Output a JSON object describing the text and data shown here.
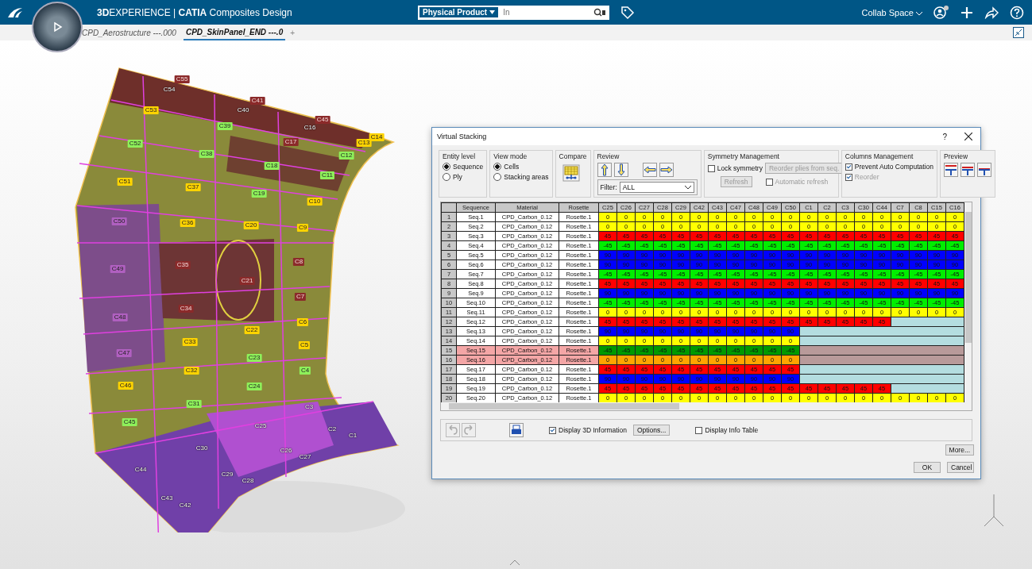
{
  "app": {
    "title": "**3D**EXPERIENCE | **CATIA** Composites Design",
    "search": {
      "scope": "Physical Product",
      "placeholder": "In"
    },
    "collab_space": "Collab Space"
  },
  "tabs": [
    {
      "label": "CPD_Aerostructure ---.000",
      "selected": false
    },
    {
      "label": "CPD_SkinPanel_END ---.0",
      "selected": true
    }
  ],
  "new_tab": "+",
  "zones": [
    {
      "label": "C55",
      "color": "#8b2a2a"
    },
    {
      "label": "C54"
    },
    {
      "label": "C41",
      "color": "#8b2a2a"
    },
    {
      "label": "C40"
    },
    {
      "label": "C45",
      "color": "#8b2a2a"
    },
    {
      "label": "C16"
    },
    {
      "label": "C14",
      "color": "#ffd400"
    },
    {
      "label": "C13",
      "color": "#ffd400"
    },
    {
      "label": "C53",
      "color": "#ffd400"
    },
    {
      "label": "C39",
      "color": "#8ef05a"
    },
    {
      "label": "C17",
      "color": "#8b2a2a"
    },
    {
      "label": "C12",
      "color": "#8ef05a"
    },
    {
      "label": "C52",
      "color": "#8ef05a"
    },
    {
      "label": "C38",
      "color": "#8ef05a"
    },
    {
      "label": "C18",
      "color": "#8ef05a"
    },
    {
      "label": "C11",
      "color": "#8ef05a"
    },
    {
      "label": "C51",
      "color": "#ffd400"
    },
    {
      "label": "C37",
      "color": "#ffd400"
    },
    {
      "label": "C19",
      "color": "#8ef05a"
    },
    {
      "label": "C10",
      "color": "#ffd400"
    },
    {
      "label": "C50",
      "color": "#b060c0"
    },
    {
      "label": "C36",
      "color": "#ffd400"
    },
    {
      "label": "C20",
      "color": "#ffd400"
    },
    {
      "label": "C9",
      "color": "#ffd400"
    },
    {
      "label": "C49",
      "color": "#b060c0"
    },
    {
      "label": "C35",
      "color": "#8b2a2a"
    },
    {
      "label": "C21",
      "color": "#8b2a2a"
    },
    {
      "label": "C8",
      "color": "#8b2a2a"
    },
    {
      "label": "C7",
      "color": "#8b2a2a"
    },
    {
      "label": "C34",
      "color": "#8b2a2a"
    },
    {
      "label": "C48",
      "color": "#b060c0"
    },
    {
      "label": "C22",
      "color": "#ffd400"
    },
    {
      "label": "C6",
      "color": "#ffd400"
    },
    {
      "label": "C33",
      "color": "#ffd400"
    },
    {
      "label": "C5",
      "color": "#ffd400"
    },
    {
      "label": "C47",
      "color": "#b060c0"
    },
    {
      "label": "C23",
      "color": "#8ef05a"
    },
    {
      "label": "C4",
      "color": "#8ef05a"
    },
    {
      "label": "C32",
      "color": "#ffd400"
    },
    {
      "label": "C46",
      "color": "#ffd400"
    },
    {
      "label": "C24",
      "color": "#8ef05a"
    },
    {
      "label": "C31",
      "color": "#8ef05a"
    },
    {
      "label": "C45",
      "color": "#8ef05a"
    },
    {
      "label": "C3"
    },
    {
      "label": "C25"
    },
    {
      "label": "C2"
    },
    {
      "label": "C1"
    },
    {
      "label": "C30"
    },
    {
      "label": "C26"
    },
    {
      "label": "C27"
    },
    {
      "label": "C44"
    },
    {
      "label": "C29"
    },
    {
      "label": "C28"
    },
    {
      "label": "C43"
    },
    {
      "label": "C42"
    }
  ],
  "dialog": {
    "title": "Virtual Stacking",
    "help": "?",
    "entity_level": {
      "label": "Entity level",
      "options": [
        {
          "label": "Sequence",
          "selected": true
        },
        {
          "label": "Ply",
          "selected": false
        }
      ]
    },
    "view_mode": {
      "label": "View mode",
      "options": [
        {
          "label": "Cells",
          "selected": true
        },
        {
          "label": "Stacking areas",
          "selected": false
        }
      ]
    },
    "compare": {
      "label": "Compare"
    },
    "review": {
      "label": "Review",
      "filter_label": "Filter:",
      "filter_value": "ALL"
    },
    "symmetry": {
      "label": "Symmetry Management",
      "lock": {
        "label": "Lock symmetry",
        "checked": false
      },
      "reorder_button": {
        "label": "Reorder plies from seq.",
        "disabled": true
      },
      "refresh_button": {
        "label": "Refresh",
        "disabled": true
      },
      "auto_refresh": {
        "label": "Automatic refresh",
        "checked": false,
        "disabled": true
      }
    },
    "columns_management": {
      "label": "Columns Management",
      "prevent": {
        "label": "Prevent Auto Computation",
        "checked": true,
        "disabled": false
      },
      "reorder": {
        "label": "Reorder",
        "checked": true,
        "disabled": true
      }
    },
    "preview": {
      "label": "Preview"
    },
    "table": {
      "columns": [
        "Sequence",
        "Material",
        "Rosette"
      ],
      "zone_columns": [
        "C25",
        "C26",
        "C27",
        "C28",
        "C29",
        "C42",
        "C43",
        "C47",
        "C48",
        "C49",
        "C50",
        "C1",
        "C2",
        "C3",
        "C30",
        "C44",
        "C7",
        "C8",
        "C15",
        "C16"
      ],
      "rows": [
        {
          "number": "1",
          "sequence": "Seq.1",
          "material": "CPD_Carbon_0.12",
          "rosette": "Rosette.1",
          "highlighted": false,
          "color": "#ffff00",
          "cells": [
            "0",
            "0",
            "0",
            "0",
            "0",
            "0",
            "0",
            "0",
            "0",
            "0",
            "0",
            "0",
            "0",
            "0",
            "0",
            "0",
            "0",
            "0",
            "0",
            "0"
          ]
        },
        {
          "number": "2",
          "sequence": "Seq.2",
          "material": "CPD_Carbon_0.12",
          "rosette": "Rosette.1",
          "highlighted": false,
          "color": "#ffff00",
          "cells": [
            "0",
            "0",
            "0",
            "0",
            "0",
            "0",
            "0",
            "0",
            "0",
            "0",
            "0",
            "0",
            "0",
            "0",
            "0",
            "0",
            "0",
            "0",
            "0",
            "0"
          ]
        },
        {
          "number": "3",
          "sequence": "Seq.3",
          "material": "CPD_Carbon_0.12",
          "rosette": "Rosette.1",
          "highlighted": false,
          "color": "#ff0000",
          "cells": [
            "45",
            "45",
            "45",
            "45",
            "45",
            "45",
            "45",
            "45",
            "45",
            "45",
            "45",
            "45",
            "45",
            "45",
            "45",
            "45",
            "45",
            "45",
            "45",
            "45"
          ]
        },
        {
          "number": "4",
          "sequence": "Seq.4",
          "material": "CPD_Carbon_0.12",
          "rosette": "Rosette.1",
          "highlighted": false,
          "color": "#00ee00",
          "cells": [
            "-45",
            "-45",
            "-45",
            "-45",
            "-45",
            "-45",
            "-45",
            "-45",
            "-45",
            "-45",
            "-45",
            "-45",
            "-45",
            "-45",
            "-45",
            "-45",
            "-45",
            "-45",
            "-45",
            "-45"
          ]
        },
        {
          "number": "5",
          "sequence": "Seq.5",
          "material": "CPD_Carbon_0.12",
          "rosette": "Rosette.1",
          "highlighted": false,
          "color": "#0000ff",
          "cells": [
            "90",
            "90",
            "90",
            "90",
            "90",
            "90",
            "90",
            "90",
            "90",
            "90",
            "90",
            "90",
            "90",
            "90",
            "90",
            "90",
            "90",
            "90",
            "90",
            "90"
          ]
        },
        {
          "number": "6",
          "sequence": "Seq.6",
          "material": "CPD_Carbon_0.12",
          "rosette": "Rosette.1",
          "highlighted": false,
          "color": "#0000ff",
          "cells": [
            "90",
            "90",
            "90",
            "90",
            "90",
            "90",
            "90",
            "90",
            "90",
            "90",
            "90",
            "90",
            "90",
            "90",
            "90",
            "90",
            "90",
            "90",
            "90",
            "90"
          ]
        },
        {
          "number": "7",
          "sequence": "Seq.7",
          "material": "CPD_Carbon_0.12",
          "rosette": "Rosette.1",
          "highlighted": false,
          "color": "#00ee00",
          "cells": [
            "-45",
            "-45",
            "-45",
            "-45",
            "-45",
            "-45",
            "-45",
            "-45",
            "-45",
            "-45",
            "-45",
            "-45",
            "-45",
            "-45",
            "-45",
            "-45",
            "-45",
            "-45",
            "-45",
            "-45"
          ]
        },
        {
          "number": "8",
          "sequence": "Seq.8",
          "material": "CPD_Carbon_0.12",
          "rosette": "Rosette.1",
          "highlighted": false,
          "color": "#ff0000",
          "cells": [
            "45",
            "45",
            "45",
            "45",
            "45",
            "45",
            "45",
            "45",
            "45",
            "45",
            "45",
            "45",
            "45",
            "45",
            "45",
            "45",
            "45",
            "45",
            "45",
            "45"
          ]
        },
        {
          "number": "9",
          "sequence": "Seq.9",
          "material": "CPD_Carbon_0.12",
          "rosette": "Rosette.1",
          "highlighted": false,
          "color": "#0000ff",
          "cells": [
            "90",
            "90",
            "90",
            "90",
            "90",
            "90",
            "90",
            "90",
            "90",
            "90",
            "90",
            "90",
            "90",
            "90",
            "90",
            "90",
            "90",
            "90",
            "90",
            "90"
          ]
        },
        {
          "number": "10",
          "sequence": "Seq.10",
          "material": "CPD_Carbon_0.12",
          "rosette": "Rosette.1",
          "highlighted": false,
          "color": "#00ee00",
          "cells": [
            "-45",
            "-45",
            "-45",
            "-45",
            "-45",
            "-45",
            "-45",
            "-45",
            "-45",
            "-45",
            "-45",
            "-45",
            "-45",
            "-45",
            "-45",
            "-45",
            "-45",
            "-45",
            "-45",
            "-45"
          ]
        },
        {
          "number": "11",
          "sequence": "Seq.11",
          "material": "CPD_Carbon_0.12",
          "rosette": "Rosette.1",
          "highlighted": false,
          "color": "#ffff00",
          "cells": [
            "0",
            "0",
            "0",
            "0",
            "0",
            "0",
            "0",
            "0",
            "0",
            "0",
            "0",
            "0",
            "0",
            "0",
            "0",
            "0",
            "0",
            "0",
            "0",
            "0"
          ]
        },
        {
          "number": "12",
          "sequence": "Seq.12",
          "material": "CPD_Carbon_0.12",
          "rosette": "Rosette.1",
          "highlighted": false,
          "color": "#ff0000",
          "blank_area": {
            "color": "#b4dde0"
          },
          "cells": [
            "45",
            "45",
            "45",
            "45",
            "45",
            "45",
            "45",
            "45",
            "45",
            "45",
            "45",
            "45",
            "45",
            "45",
            "45",
            "45"
          ]
        },
        {
          "number": "13",
          "sequence": "Seq.13",
          "material": "CPD_Carbon_0.12",
          "rosette": "Rosette.1",
          "highlighted": false,
          "color": "#0000ff",
          "blank_area": {
            "color": "#b4dde0"
          },
          "cells": [
            "90",
            "90",
            "90",
            "90",
            "90",
            "90",
            "90",
            "90",
            "90",
            "90",
            "90"
          ]
        },
        {
          "number": "14",
          "sequence": "Seq.14",
          "material": "CPD_Carbon_0.12",
          "rosette": "Rosette.1",
          "highlighted": false,
          "color": "#ffff00",
          "blank_area": {
            "color": "#b4dde0"
          },
          "cells": [
            "0",
            "0",
            "0",
            "0",
            "0",
            "0",
            "0",
            "0",
            "0",
            "0",
            "0"
          ]
        },
        {
          "number": "15",
          "sequence": "Seq.15",
          "material": "CPD_Carbon_0.12",
          "rosette": "Rosette.1",
          "highlighted": true,
          "color": "#009900",
          "blank_area": {
            "color": "#b89a9a"
          },
          "cells": [
            "-45",
            "-45",
            "-45",
            "-45",
            "-45",
            "-45",
            "-45",
            "-45",
            "-45",
            "-45",
            "-45"
          ]
        },
        {
          "number": "16",
          "sequence": "Seq.16",
          "material": "CPD_Carbon_0.12",
          "rosette": "Rosette.1",
          "highlighted": true,
          "color": "#ffa500",
          "blank_area": {
            "color": "#b89a9a"
          },
          "cells": [
            "0",
            "0",
            "0",
            "0",
            "0",
            "0",
            "0",
            "0",
            "0",
            "0",
            "0"
          ]
        },
        {
          "number": "17",
          "sequence": "Seq.17",
          "material": "CPD_Carbon_0.12",
          "rosette": "Rosette.1",
          "highlighted": false,
          "color": "#ff0000",
          "blank_area": {
            "color": "#b4dde0"
          },
          "cells": [
            "45",
            "45",
            "45",
            "45",
            "45",
            "45",
            "45",
            "45",
            "45",
            "45",
            "45"
          ]
        },
        {
          "number": "18",
          "sequence": "Seq.18",
          "material": "CPD_Carbon_0.12",
          "rosette": "Rosette.1",
          "highlighted": false,
          "color": "#0000ff",
          "blank_area": {
            "color": "#b4dde0"
          },
          "cells": [
            "90",
            "90",
            "90",
            "90",
            "90",
            "90",
            "90",
            "90",
            "90",
            "90",
            "90"
          ]
        },
        {
          "number": "19",
          "sequence": "Seq.19",
          "material": "CPD_Carbon_0.12",
          "rosette": "Rosette.1",
          "highlighted": false,
          "color": "#ff0000",
          "blank_area": {
            "color": "#b4dde0"
          },
          "cells": [
            "45",
            "45",
            "45",
            "45",
            "45",
            "45",
            "45",
            "45",
            "45",
            "45",
            "45",
            "45",
            "45",
            "45",
            "45",
            "45"
          ]
        },
        {
          "number": "20",
          "sequence": "Seq.20",
          "material": "CPD_Carbon_0.12",
          "rosette": "Rosette.1",
          "highlighted": false,
          "color": "#ffff00",
          "cells": [
            "0",
            "0",
            "0",
            "0",
            "0",
            "0",
            "0",
            "0",
            "0",
            "0",
            "0",
            "0",
            "0",
            "0",
            "0",
            "0",
            "0",
            "0",
            "0",
            "0"
          ]
        }
      ]
    },
    "display_3d": {
      "label": "Display 3D Information",
      "checked": true
    },
    "options_button": "Options...",
    "display_info_table": {
      "label": "Display Info Table",
      "checked": false
    },
    "buttons": {
      "more": "More...",
      "ok": "OK",
      "cancel": "Cancel"
    }
  }
}
